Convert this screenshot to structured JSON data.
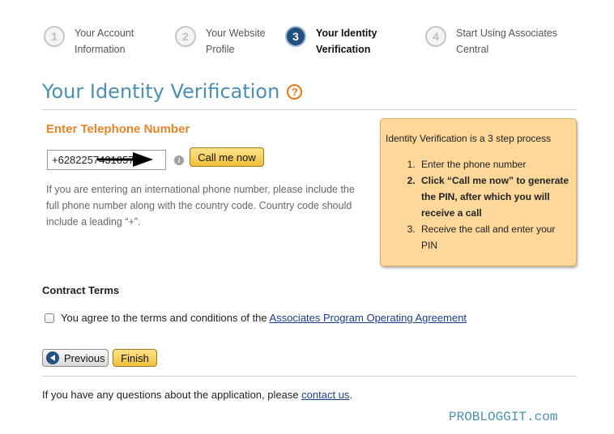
{
  "steps": [
    {
      "number": "1",
      "line1": "Your Account",
      "line2": "Information",
      "active": false
    },
    {
      "number": "2",
      "line1": "Your Website",
      "line2": "Profile",
      "active": false
    },
    {
      "number": "3",
      "line1": "Your Identity",
      "line2": "Verification",
      "active": true
    },
    {
      "number": "4",
      "line1": "Start Using Associates",
      "line2": "Central",
      "active": false
    }
  ],
  "page": {
    "title": "Your Identity Verification",
    "help_icon": "?"
  },
  "phone": {
    "section_title": "Enter Telephone Number",
    "value": "+6282257431057",
    "info_icon": "i",
    "call_button": "Call me now",
    "help_text": "If you are entering an international phone number, please include the full phone number along with the country code. Country code should include a leading “+”."
  },
  "process": {
    "intro": "Identity Verification is a 3 step process",
    "steps": [
      "Enter the phone number",
      "Click “Call me now” to generate the PIN, after which you will receive a call",
      "Receive the call and enter your PIN"
    ]
  },
  "contract": {
    "title": "Contract Terms",
    "agree_text": "You agree to the terms and conditions of the ",
    "agree_link": "Associates Program Operating Agreement"
  },
  "nav": {
    "previous": "Previous",
    "finish": "Finish"
  },
  "footer": {
    "text": "If you have any questions about the application, please ",
    "link": "contact us",
    "suffix": "."
  },
  "watermark": "PROBLOGGIT.com",
  "colors": {
    "title": "#4c8fb2",
    "accent_orange": "#e8852b",
    "info_box": "#fdd89a",
    "active_step": "#22507f",
    "link": "#1b3c8f"
  }
}
